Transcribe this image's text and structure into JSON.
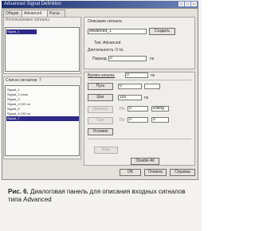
{
  "window": {
    "title": "Advanced Signal Definition"
  },
  "tabs": [
    {
      "label": "Общие"
    },
    {
      "label": "Advanced"
    },
    {
      "label": "Расш."
    }
  ],
  "left_top": {
    "header": "Используемые сигналы",
    "items": [
      "Signal_1"
    ]
  },
  "left_bottom": {
    "header": "Список сигналов: 7",
    "items": [
      "Signal_1",
      "Signal_2 clock",
      "Signal_3",
      "Signal_4 100 ns",
      "Signal_5",
      "Signal_6 100 ns",
      "Signal_7"
    ],
    "selected_index": 6
  },
  "right_top": {
    "header": "Описание сигнала",
    "name_value": "Advanced_1",
    "apply_label": "Создать",
    "line1": "Тип: Advanced",
    "line2": "Длительность: 0 ns",
    "period_label": "Период:",
    "period_value": "0",
    "period_unit": "ns"
  },
  "right_bottom": {
    "time_label": "Время начала:",
    "time_value": "0",
    "time_unit": "ns",
    "buttons": [
      "Пуск",
      "Шаг",
      "Уровень",
      "Такт",
      "Условие"
    ],
    "row1_value": "0",
    "row2_value": "100",
    "row2_unit": "ns",
    "row3_label": "По",
    "row3_value": "0",
    "row3_combo": "Rising",
    "row4_label": "По",
    "row4_value": "0",
    "row4_combo": "0",
    "edit_label": "Изм.",
    "disable_label": "Disable All"
  },
  "footer": {
    "ok": "OK",
    "cancel": "Отмена",
    "help": "Справка"
  },
  "caption": {
    "prefix": "Рис. 6.",
    "text": " Диалоговая панель для описания входных сигналов типа Advanced"
  }
}
